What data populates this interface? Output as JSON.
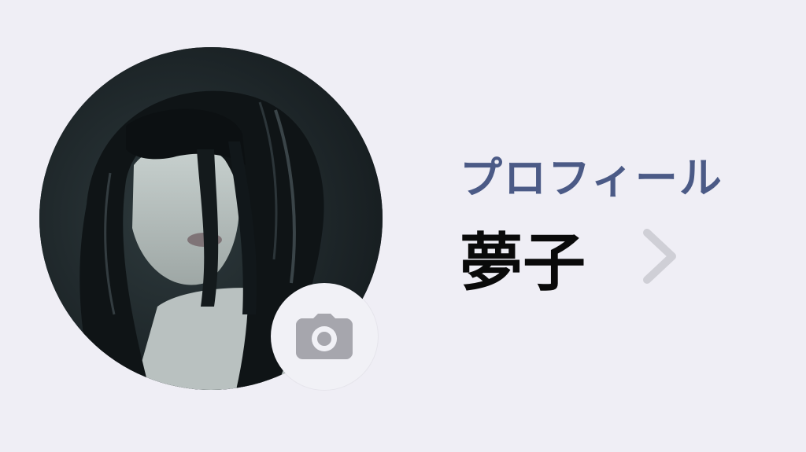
{
  "profile": {
    "section_label": "プロフィール",
    "display_name": "夢子"
  },
  "avatar": {
    "icon": "profile-photo"
  },
  "camera_button": {
    "icon": "camera-icon"
  },
  "navigation": {
    "icon": "chevron-right-icon"
  },
  "colors": {
    "background": "#efeef5",
    "label": "#4b5a86",
    "name": "#0a0a0a",
    "chevron": "#cfcfd6",
    "camera_icon": "#a6a6ad",
    "camera_button_bg": "#f1f1f6"
  }
}
